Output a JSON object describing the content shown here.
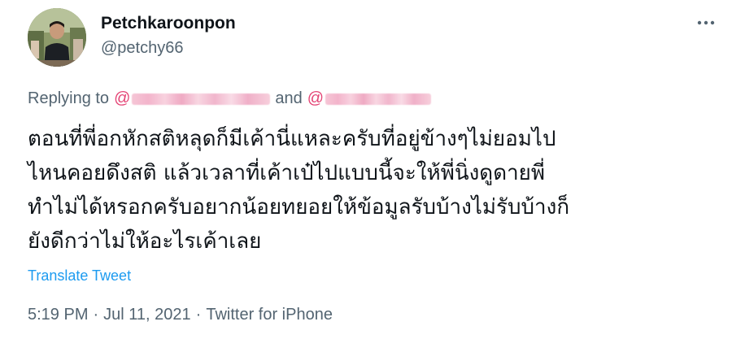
{
  "author": {
    "display_name": "Petchkaroonpon",
    "handle": "@petchy66"
  },
  "reply": {
    "label": "Replying to",
    "mention_prefix_1": "@",
    "conjunction": "and",
    "mention_prefix_2": "@"
  },
  "tweet": {
    "lines": [
      "ตอนที่พี่อกหักสติหลุดก็มีเค้านี่แหละครับที่อยู่ข้างๆไม่ยอมไป",
      "ไหนคอยดึงสติ แล้วเวลาที่เค้าเป๋ไปแบบนี้จะให้พี่นิ่งดูดายพี่",
      "ทำไม่ได้หรอกครับอยากน้อยทยอยให้ข้อมูลรับบ้างไม่รับบ้างก็",
      "ยังดีกว่าไม่ให้อะไรเค้าเลย"
    ],
    "translate_label": "Translate Tweet"
  },
  "meta": {
    "time": "5:19 PM",
    "separator": "·",
    "date": "Jul 11, 2021",
    "source": "Twitter for iPhone"
  },
  "icons": {
    "more": "more-options-icon"
  },
  "colors": {
    "link": "#1d9bf0",
    "secondary_text": "#536471",
    "primary_text": "#0f1419"
  }
}
